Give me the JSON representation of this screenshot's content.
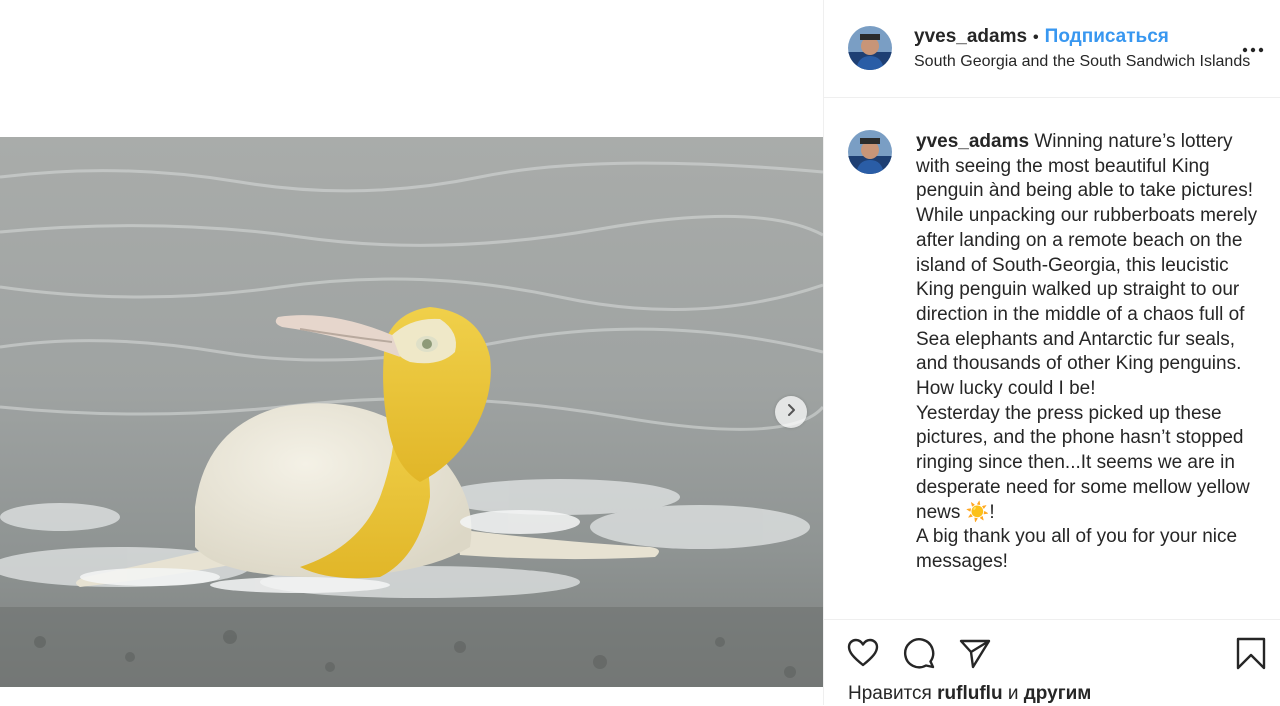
{
  "post": {
    "username": "yves_adams",
    "separator": "•",
    "follow_label": "Подписаться",
    "location": "South Georgia and the South Sandwich Islands",
    "more_icon": "more-horizontal-icon",
    "next_icon": "chevron-right-icon"
  },
  "caption": {
    "username": "yves_adams",
    "line1": " Winning nature’s lottery with seeing the most beautiful King penguin ànd being able to take pictures! While unpacking our rubberboats merely after landing on a remote beach on the island of South-Georgia, this leucistic King penguin walked up straight to our direction in the middle of a chaos full of Sea elephants and Antarctic fur seals, and thousands of other King penguins. How lucky could I be!",
    "line2_a": "Yesterday the press picked up these pictures, and the phone hasn’t stopped ringing since then...It seems we are in desperate need for some mellow yellow news ",
    "emoji": "☀️",
    "line2_b": "!",
    "line3": "A big thank you all of you for your nice messages!"
  },
  "actions": {
    "like_icon": "heart-icon",
    "comment_icon": "comment-icon",
    "share_icon": "share-icon",
    "save_icon": "bookmark-icon"
  },
  "likes": {
    "prefix": "Нравится ",
    "user": "rufluflu",
    "middle": " и ",
    "suffix": "другим"
  },
  "colors": {
    "follow": "#3897f0",
    "text": "#262626",
    "border": "#efefef"
  }
}
